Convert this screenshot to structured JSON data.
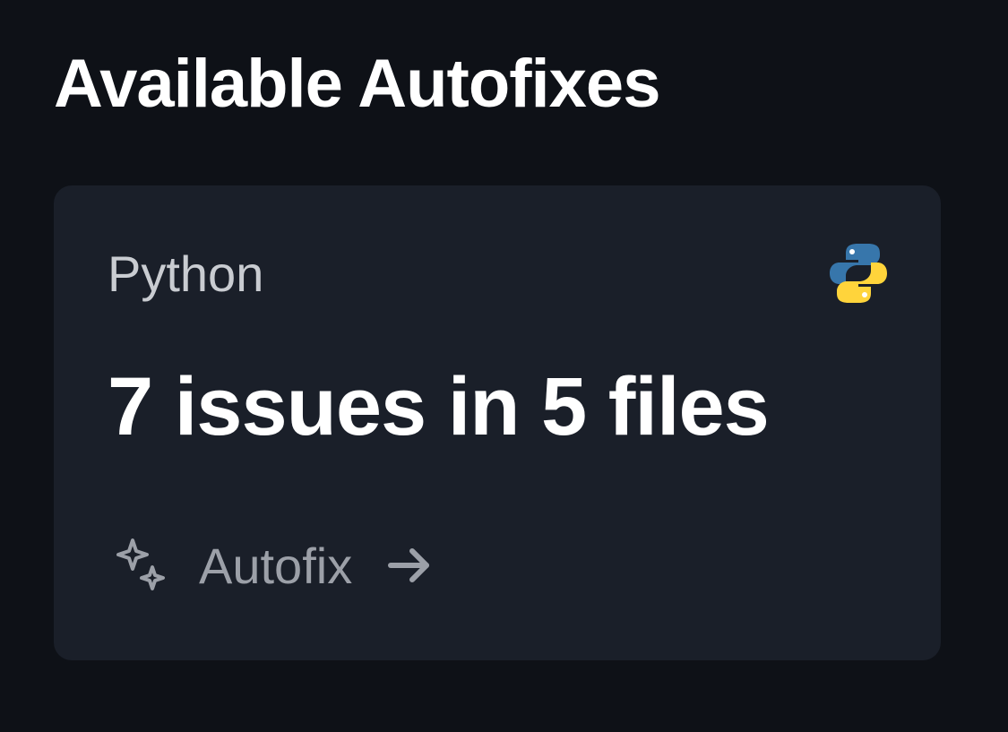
{
  "page": {
    "title": "Available Autofixes"
  },
  "card": {
    "language": "Python",
    "language_icon": "python-icon",
    "summary": "7 issues in 5 files",
    "issues_count": 7,
    "files_count": 5,
    "action": {
      "label": "Autofix",
      "icon": "sparkles-icon"
    }
  },
  "colors": {
    "background": "#0e1117",
    "card_background": "#1a1f29",
    "text_primary": "#ffffff",
    "text_secondary": "#c9ccd1",
    "text_muted": "#9ca0a8",
    "python_blue": "#3776ab",
    "python_yellow": "#ffd43b"
  }
}
